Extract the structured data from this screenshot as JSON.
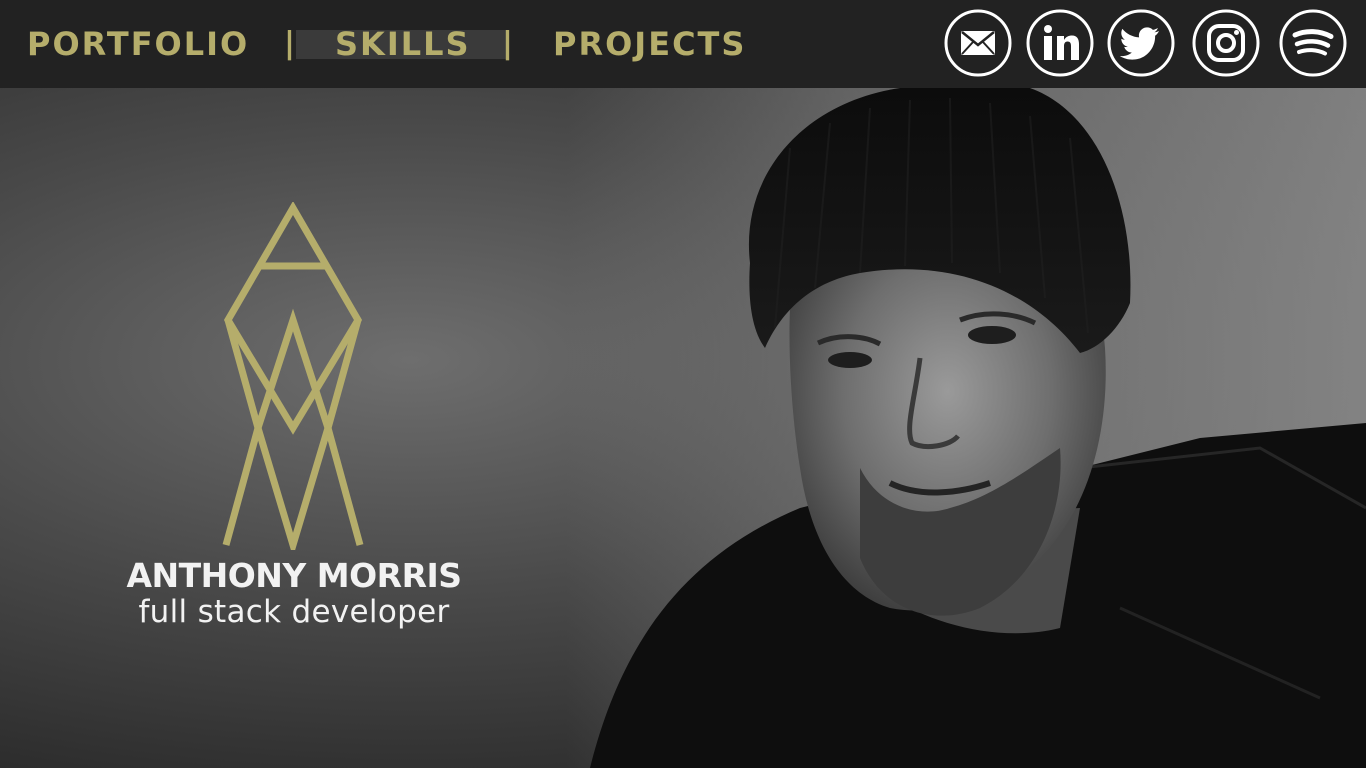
{
  "nav": {
    "items": [
      {
        "label": "PORTFOLIO"
      },
      {
        "label": "SKILLS"
      },
      {
        "label": "PROJECTS"
      }
    ],
    "separator": "|",
    "active": "SKILLS"
  },
  "social": [
    {
      "icon": "mail-icon"
    },
    {
      "icon": "linkedin-icon"
    },
    {
      "icon": "twitter-icon"
    },
    {
      "icon": "instagram-icon"
    },
    {
      "icon": "spotify-icon"
    }
  ],
  "hero": {
    "name": "ANTHONY MORRIS",
    "role": "full stack developer"
  },
  "colors": {
    "accent": "#b5ad6b",
    "bar": "#222222",
    "text_light": "#f2f2f2"
  }
}
